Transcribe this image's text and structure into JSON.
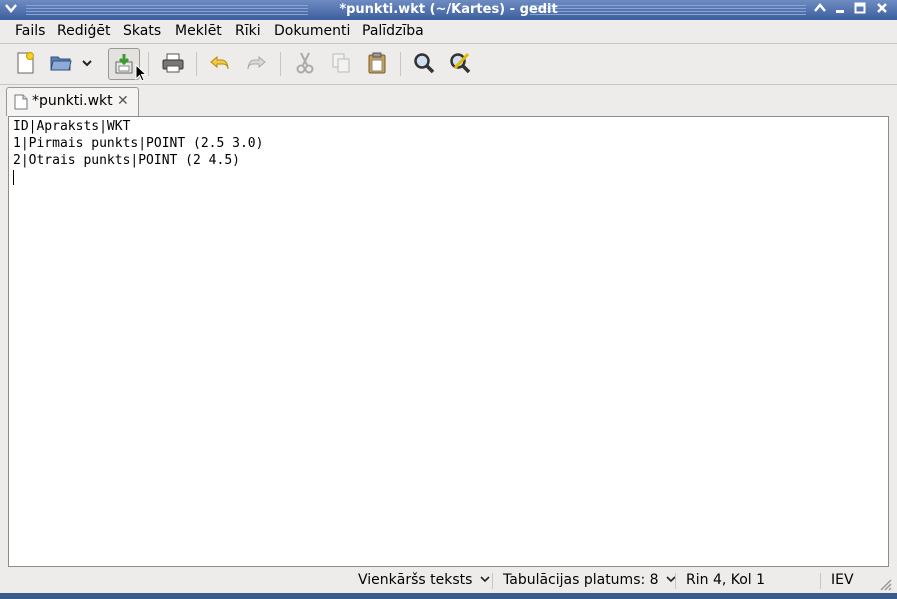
{
  "window": {
    "title": "*punkti.wkt (~/Kartes) - gedit"
  },
  "menubar": {
    "items": [
      "Fails",
      "Rediģēt",
      "Skats",
      "Meklēt",
      "Rīki",
      "Dokumenti",
      "Palīdzība"
    ]
  },
  "toolbar": {
    "icons": [
      "new-document-icon",
      "open-folder-icon",
      "dropdown-arrow-icon",
      "save-icon",
      "print-icon",
      "undo-icon",
      "redo-icon",
      "cut-icon",
      "copy-icon",
      "paste-icon",
      "search-icon",
      "search-replace-icon"
    ]
  },
  "tab": {
    "label": "*punkti.wkt"
  },
  "editor": {
    "lines": [
      "ID|Apraksts|WKT",
      "1|Pirmais punkts|POINT (2.5 3.0)",
      "2|Otrais punkts|POINT (2 4.5)"
    ]
  },
  "statusbar": {
    "language": "Vienkāršs teksts",
    "tab_width": "Tabulācijas platums:  8",
    "position": "Rin 4, Kol 1",
    "mode": "IEV"
  },
  "colors": {
    "titlebar": "#3c5e9f",
    "window_bg": "#edeceb",
    "editor_bg": "#ffffff"
  }
}
